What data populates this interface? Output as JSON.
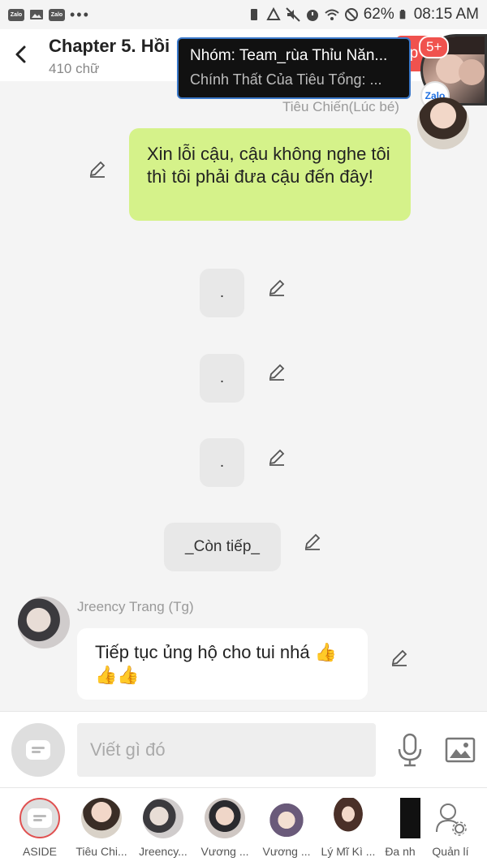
{
  "status_bar": {
    "battery": "62%",
    "time": "08:15 AM"
  },
  "header": {
    "title": "Chapter 5. Hồi",
    "subtitle": "410 chữ",
    "next_label": "ếp",
    "badge": "5+"
  },
  "notification": {
    "title": "Nhóm: Team_rùa Thỉu Năn...",
    "message": "Chính Thất Của Tiêu Tổng: ..."
  },
  "zalo_badge": "Zalo",
  "messages": {
    "m1_sender": "Tiêu Chiến(Lúc bé)",
    "m1_text": "Xin lỗi cậu, cậu không nghe tôi thì tôi phải đưa cậu đến đây!",
    "m2_text": ".",
    "m3_text": ".",
    "m4_text": ".",
    "m5_text": "_Còn tiếp_",
    "m6_sender": "Jreency Trang (Tg)",
    "m6_text": "Tiếp tục ủng hộ cho tui nhá 👍👍👍"
  },
  "input": {
    "placeholder": "Viết gì đó"
  },
  "nav": {
    "items": [
      {
        "label": "ASIDE"
      },
      {
        "label": "Tiêu Chi..."
      },
      {
        "label": "Jreency..."
      },
      {
        "label": "Vương ..."
      },
      {
        "label": "Vương ..."
      },
      {
        "label": "Lý Mĩ Kì ..."
      },
      {
        "label": "Đa nh"
      },
      {
        "label": "Quản lí"
      }
    ]
  },
  "colors": {
    "accent": "#f0524e",
    "bubble_green": "#d5f28a",
    "notif_border": "#3a78c9"
  }
}
